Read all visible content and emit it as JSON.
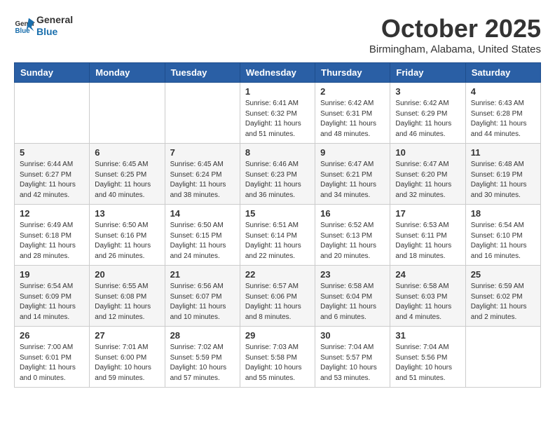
{
  "header": {
    "logo_line1": "General",
    "logo_line2": "Blue",
    "title": "October 2025",
    "subtitle": "Birmingham, Alabama, United States"
  },
  "weekdays": [
    "Sunday",
    "Monday",
    "Tuesday",
    "Wednesday",
    "Thursday",
    "Friday",
    "Saturday"
  ],
  "weeks": [
    [
      {
        "day": "",
        "info": ""
      },
      {
        "day": "",
        "info": ""
      },
      {
        "day": "",
        "info": ""
      },
      {
        "day": "1",
        "info": "Sunrise: 6:41 AM\nSunset: 6:32 PM\nDaylight: 11 hours\nand 51 minutes."
      },
      {
        "day": "2",
        "info": "Sunrise: 6:42 AM\nSunset: 6:31 PM\nDaylight: 11 hours\nand 48 minutes."
      },
      {
        "day": "3",
        "info": "Sunrise: 6:42 AM\nSunset: 6:29 PM\nDaylight: 11 hours\nand 46 minutes."
      },
      {
        "day": "4",
        "info": "Sunrise: 6:43 AM\nSunset: 6:28 PM\nDaylight: 11 hours\nand 44 minutes."
      }
    ],
    [
      {
        "day": "5",
        "info": "Sunrise: 6:44 AM\nSunset: 6:27 PM\nDaylight: 11 hours\nand 42 minutes."
      },
      {
        "day": "6",
        "info": "Sunrise: 6:45 AM\nSunset: 6:25 PM\nDaylight: 11 hours\nand 40 minutes."
      },
      {
        "day": "7",
        "info": "Sunrise: 6:45 AM\nSunset: 6:24 PM\nDaylight: 11 hours\nand 38 minutes."
      },
      {
        "day": "8",
        "info": "Sunrise: 6:46 AM\nSunset: 6:23 PM\nDaylight: 11 hours\nand 36 minutes."
      },
      {
        "day": "9",
        "info": "Sunrise: 6:47 AM\nSunset: 6:21 PM\nDaylight: 11 hours\nand 34 minutes."
      },
      {
        "day": "10",
        "info": "Sunrise: 6:47 AM\nSunset: 6:20 PM\nDaylight: 11 hours\nand 32 minutes."
      },
      {
        "day": "11",
        "info": "Sunrise: 6:48 AM\nSunset: 6:19 PM\nDaylight: 11 hours\nand 30 minutes."
      }
    ],
    [
      {
        "day": "12",
        "info": "Sunrise: 6:49 AM\nSunset: 6:18 PM\nDaylight: 11 hours\nand 28 minutes."
      },
      {
        "day": "13",
        "info": "Sunrise: 6:50 AM\nSunset: 6:16 PM\nDaylight: 11 hours\nand 26 minutes."
      },
      {
        "day": "14",
        "info": "Sunrise: 6:50 AM\nSunset: 6:15 PM\nDaylight: 11 hours\nand 24 minutes."
      },
      {
        "day": "15",
        "info": "Sunrise: 6:51 AM\nSunset: 6:14 PM\nDaylight: 11 hours\nand 22 minutes."
      },
      {
        "day": "16",
        "info": "Sunrise: 6:52 AM\nSunset: 6:13 PM\nDaylight: 11 hours\nand 20 minutes."
      },
      {
        "day": "17",
        "info": "Sunrise: 6:53 AM\nSunset: 6:11 PM\nDaylight: 11 hours\nand 18 minutes."
      },
      {
        "day": "18",
        "info": "Sunrise: 6:54 AM\nSunset: 6:10 PM\nDaylight: 11 hours\nand 16 minutes."
      }
    ],
    [
      {
        "day": "19",
        "info": "Sunrise: 6:54 AM\nSunset: 6:09 PM\nDaylight: 11 hours\nand 14 minutes."
      },
      {
        "day": "20",
        "info": "Sunrise: 6:55 AM\nSunset: 6:08 PM\nDaylight: 11 hours\nand 12 minutes."
      },
      {
        "day": "21",
        "info": "Sunrise: 6:56 AM\nSunset: 6:07 PM\nDaylight: 11 hours\nand 10 minutes."
      },
      {
        "day": "22",
        "info": "Sunrise: 6:57 AM\nSunset: 6:06 PM\nDaylight: 11 hours\nand 8 minutes."
      },
      {
        "day": "23",
        "info": "Sunrise: 6:58 AM\nSunset: 6:04 PM\nDaylight: 11 hours\nand 6 minutes."
      },
      {
        "day": "24",
        "info": "Sunrise: 6:58 AM\nSunset: 6:03 PM\nDaylight: 11 hours\nand 4 minutes."
      },
      {
        "day": "25",
        "info": "Sunrise: 6:59 AM\nSunset: 6:02 PM\nDaylight: 11 hours\nand 2 minutes."
      }
    ],
    [
      {
        "day": "26",
        "info": "Sunrise: 7:00 AM\nSunset: 6:01 PM\nDaylight: 11 hours\nand 0 minutes."
      },
      {
        "day": "27",
        "info": "Sunrise: 7:01 AM\nSunset: 6:00 PM\nDaylight: 10 hours\nand 59 minutes."
      },
      {
        "day": "28",
        "info": "Sunrise: 7:02 AM\nSunset: 5:59 PM\nDaylight: 10 hours\nand 57 minutes."
      },
      {
        "day": "29",
        "info": "Sunrise: 7:03 AM\nSunset: 5:58 PM\nDaylight: 10 hours\nand 55 minutes."
      },
      {
        "day": "30",
        "info": "Sunrise: 7:04 AM\nSunset: 5:57 PM\nDaylight: 10 hours\nand 53 minutes."
      },
      {
        "day": "31",
        "info": "Sunrise: 7:04 AM\nSunset: 5:56 PM\nDaylight: 10 hours\nand 51 minutes."
      },
      {
        "day": "",
        "info": ""
      }
    ]
  ]
}
